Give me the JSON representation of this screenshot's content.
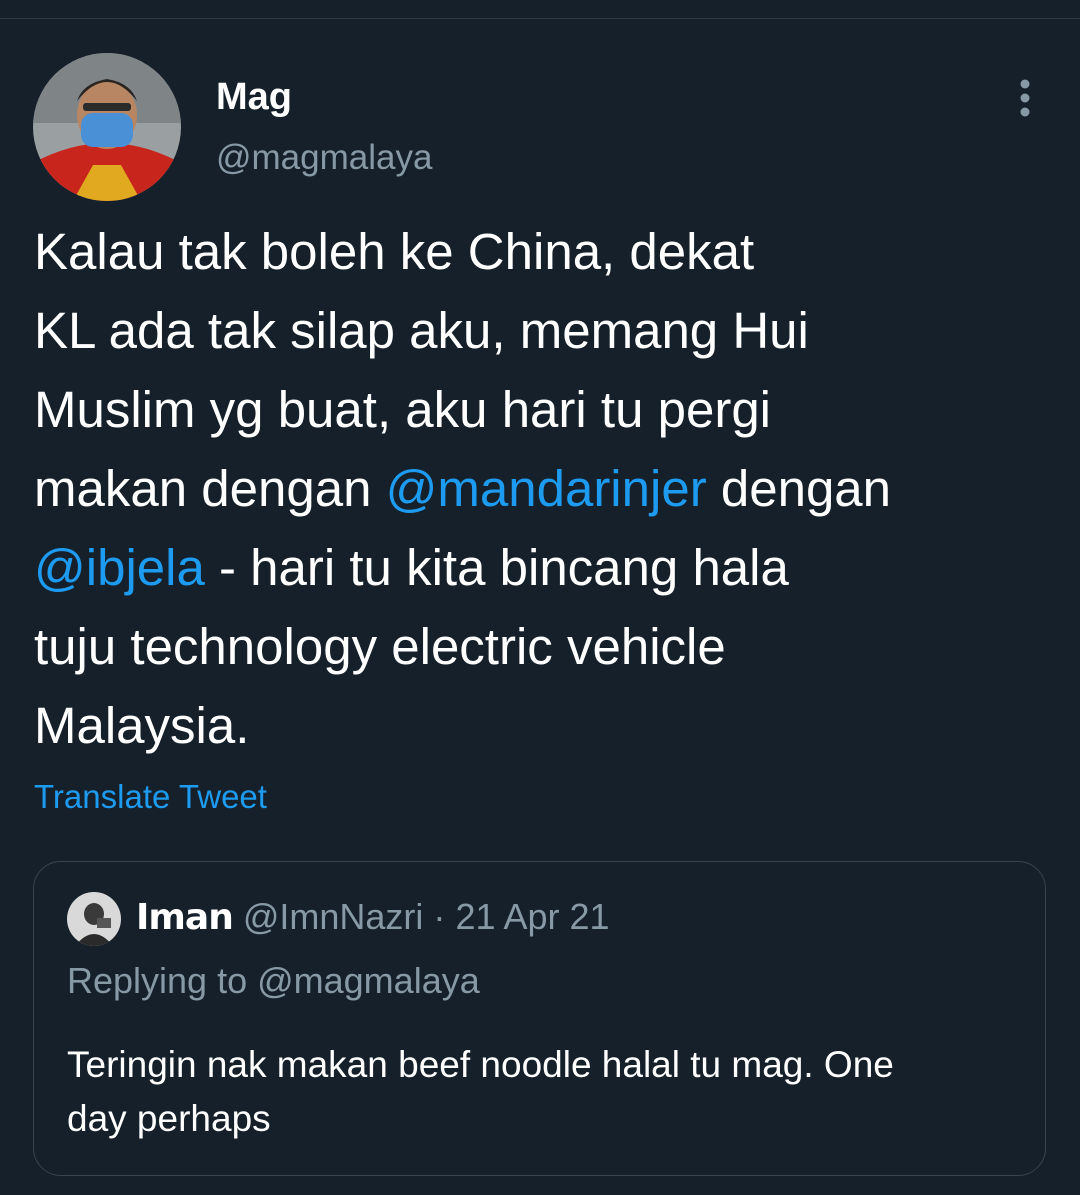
{
  "tweet": {
    "author": {
      "display_name": "Mag",
      "handle": "@magmalaya",
      "avatar_icon": "user-avatar-photo"
    },
    "text_segments": [
      "Kalau tak boleh ke China, dekat",
      "KL ada tak silap aku, memang Hui",
      "Muslim yg buat, aku hari tu pergi",
      "makan dengan ",
      "@mandarinjer",
      " dengan",
      "@ibjela",
      " - hari tu kita bincang hala",
      "tuju technology electric vehicle",
      "Malaysia."
    ],
    "translate_label": "Translate Tweet",
    "more_icon": "more-vertical-icon"
  },
  "quoted_tweet": {
    "author": {
      "display_name": "Iman",
      "handle": "@ImnNazri",
      "separator": "·",
      "date": "21 Apr 21"
    },
    "replying_to": "Replying to @magmalaya",
    "text_line_1": "Teringin nak makan beef noodle halal tu mag. One",
    "text_line_2": "day perhaps"
  },
  "colors": {
    "background": "#15202b",
    "text": "#ffffff",
    "secondary_text": "#8899a6",
    "link": "#1d9bf0",
    "border": "#38444d"
  }
}
